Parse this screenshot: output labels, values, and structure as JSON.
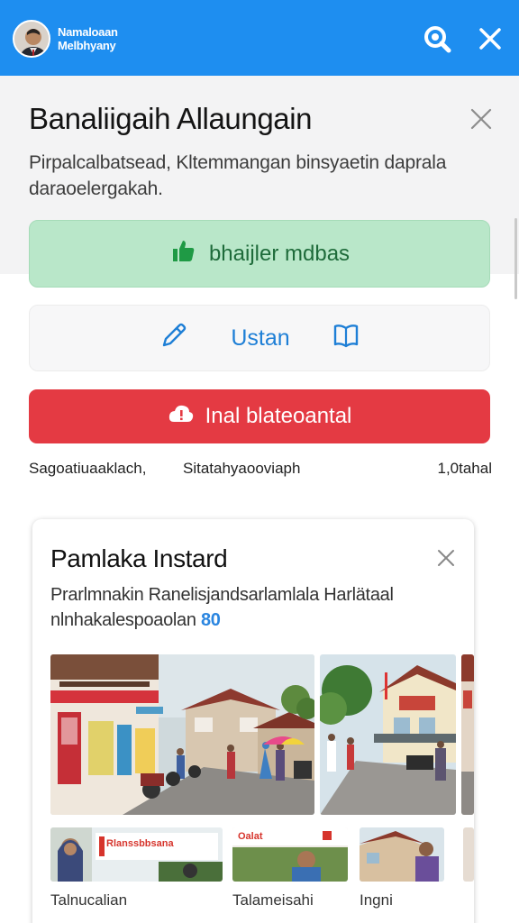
{
  "header": {
    "app_name_line1": "Namaloaan",
    "app_name_line2": "Melbhyany",
    "search_icon": "search-icon",
    "close_icon": "close-icon",
    "color": "#1e8ef0"
  },
  "dialog": {
    "title": "Banaliigaih Allaungain",
    "description": "Pirpalcalbatsead, Kltemmangan binsyaetin daprala daraoelergakah.",
    "close_icon": "close-icon"
  },
  "actions": {
    "primary_label": "bhaijler mdbas",
    "primary_icon": "thumbs-up-icon",
    "primary_color": "#b9e7c9",
    "edit_label": "Ustan",
    "edit_icon": "pencil-icon",
    "bookmark_icon": "book-icon",
    "report_label": "Inal blateoantal",
    "report_icon": "cloud-alert-icon",
    "report_color": "#e43a43"
  },
  "meta": {
    "left": "Sagoatiuaaklach,",
    "middle": "Sitatahyaooviaph",
    "right": "1,0tahal"
  },
  "card": {
    "title": "Pamlaka Instard",
    "description_line1": "Prarlmnakin Ranelisjandsarlamlala Harlätaal",
    "description_line2": "nlnhakalespoaolan",
    "description_symbol": "80",
    "close_icon": "close-icon",
    "photos": [
      {
        "alt": "street-scene-photo"
      },
      {
        "alt": "village-road-photo"
      }
    ],
    "thumbnails": [
      {
        "label": "Talnucalian",
        "caption": "Rlanssbbsana"
      },
      {
        "label": "Talameisahi",
        "caption": "Oalat"
      },
      {
        "label": "Ingni"
      }
    ]
  }
}
